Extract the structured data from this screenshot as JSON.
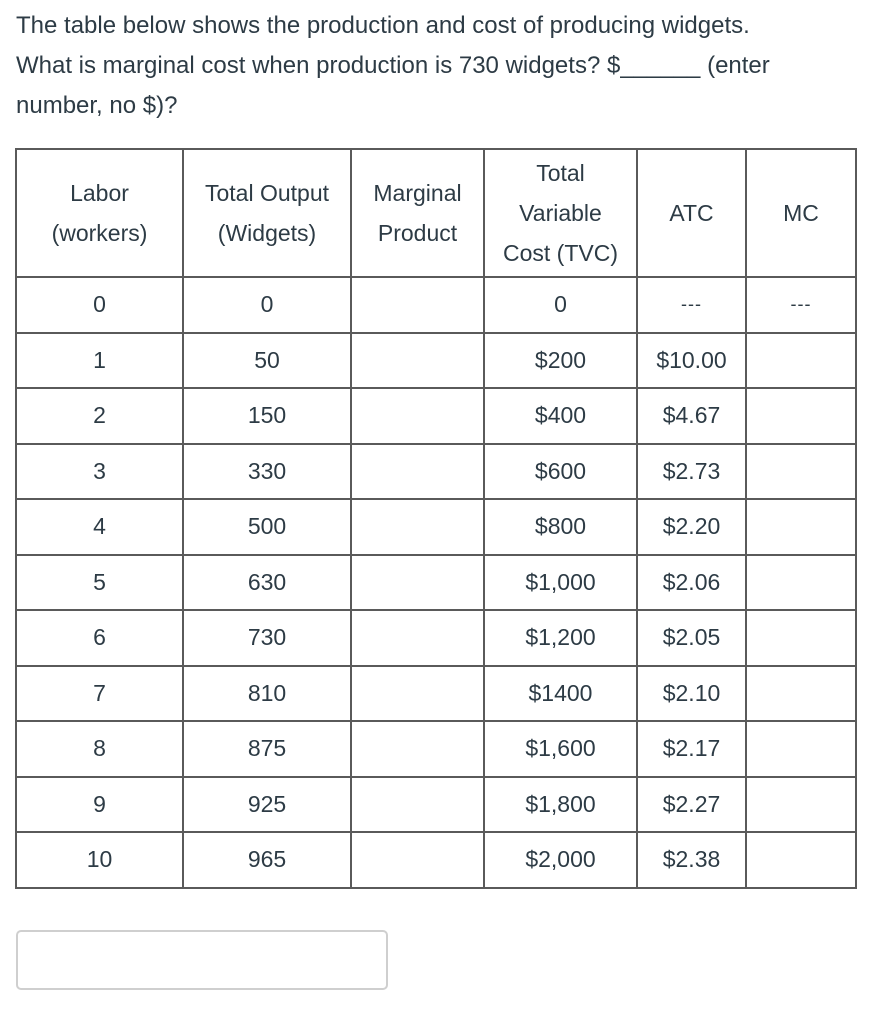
{
  "question": {
    "line1": "The table below shows the production and cost of producing widgets.",
    "line2_prefix": "What is marginal cost when production is 730 widgets? $",
    "blank": "______",
    "line2_suffix": " (enter",
    "line3": "number, no $)?"
  },
  "table": {
    "headers": [
      {
        "line1": "Labor",
        "line2": "(workers)"
      },
      {
        "line1": "Total Output",
        "line2": "(Widgets)"
      },
      {
        "line1": "Marginal",
        "line2": "Product"
      },
      {
        "line1": "Total",
        "line2": "Variable",
        "line3": "Cost (TVC)"
      },
      {
        "line1": "ATC"
      },
      {
        "line1": "MC"
      }
    ],
    "rows": [
      {
        "labor": "0",
        "output": "0",
        "mp": "",
        "tvc": "0",
        "atc": "---",
        "mc": "---"
      },
      {
        "labor": "1",
        "output": "50",
        "mp": "",
        "tvc": "$200",
        "atc": "$10.00",
        "mc": ""
      },
      {
        "labor": "2",
        "output": "150",
        "mp": "",
        "tvc": "$400",
        "atc": "$4.67",
        "mc": ""
      },
      {
        "labor": "3",
        "output": "330",
        "mp": "",
        "tvc": "$600",
        "atc": "$2.73",
        "mc": ""
      },
      {
        "labor": "4",
        "output": "500",
        "mp": "",
        "tvc": "$800",
        "atc": "$2.20",
        "mc": ""
      },
      {
        "labor": "5",
        "output": "630",
        "mp": "",
        "tvc": "$1,000",
        "atc": "$2.06",
        "mc": ""
      },
      {
        "labor": "6",
        "output": "730",
        "mp": "",
        "tvc": "$1,200",
        "atc": "$2.05",
        "mc": ""
      },
      {
        "labor": "7",
        "output": "810",
        "mp": "",
        "tvc": "$1400",
        "atc": "$2.10",
        "mc": ""
      },
      {
        "labor": "8",
        "output": "875",
        "mp": "",
        "tvc": "$1,600",
        "atc": "$2.17",
        "mc": ""
      },
      {
        "labor": "9",
        "output": "925",
        "mp": "",
        "tvc": "$1,800",
        "atc": "$2.27",
        "mc": ""
      },
      {
        "labor": "10",
        "output": "965",
        "mp": "",
        "tvc": "$2,000",
        "atc": "$2.38",
        "mc": ""
      }
    ]
  },
  "answer": {
    "value": "",
    "placeholder": ""
  }
}
